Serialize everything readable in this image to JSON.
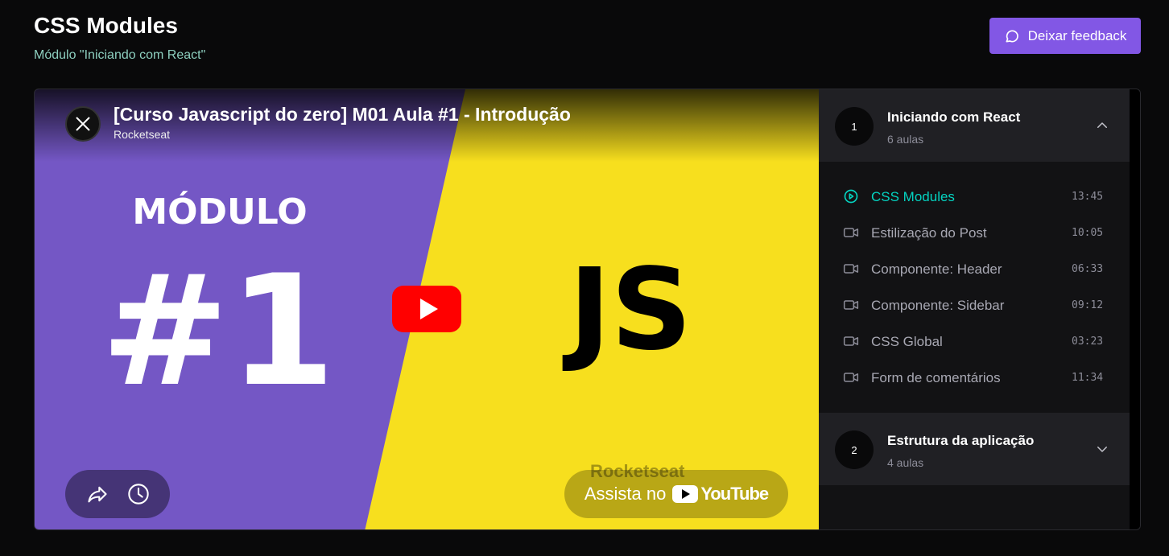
{
  "page": {
    "title": "CSS Modules",
    "subtitle": "Módulo \"Iniciando com React\""
  },
  "feedback_button": {
    "label": "Deixar feedback",
    "icon": "chat-bubble-icon"
  },
  "video": {
    "title": "[Curso Javascript do zero] M01 Aula #1 - Introdução",
    "channel": "Rocketseat",
    "thumbnail": {
      "modulo_text": "MÓDULO",
      "number_text": "#1",
      "js_text": "JS",
      "left_color": "#7457c5",
      "right_color": "#f7df1e"
    },
    "watermark": "Rocketseat",
    "watch_on": {
      "text": "Assista no",
      "brand": "YouTube"
    },
    "controls": [
      "share-icon",
      "watch-later-icon"
    ]
  },
  "sidebar": {
    "modules": [
      {
        "number": "1",
        "title": "Iniciando com React",
        "count": "6 aulas",
        "expanded": true,
        "lessons": [
          {
            "title": "CSS Modules",
            "time": "13:45",
            "active": true,
            "icon": "play-circle-icon"
          },
          {
            "title": "Estilização do Post",
            "time": "10:05",
            "active": false,
            "icon": "video-camera-icon"
          },
          {
            "title": "Componente: Header",
            "time": "06:33",
            "active": false,
            "icon": "video-camera-icon"
          },
          {
            "title": "Componente: Sidebar",
            "time": "09:12",
            "active": false,
            "icon": "video-camera-icon"
          },
          {
            "title": "CSS Global",
            "time": "03:23",
            "active": false,
            "icon": "video-camera-icon"
          },
          {
            "title": "Form de comentários",
            "time": "11:34",
            "active": false,
            "icon": "video-camera-icon"
          }
        ]
      },
      {
        "number": "2",
        "title": "Estrutura da aplicação",
        "count": "4 aulas",
        "expanded": false,
        "lessons": []
      }
    ]
  },
  "colors": {
    "accent": "#8257e5",
    "active_lesson": "#04d3c1",
    "subtitle": "#8dcfbf"
  }
}
